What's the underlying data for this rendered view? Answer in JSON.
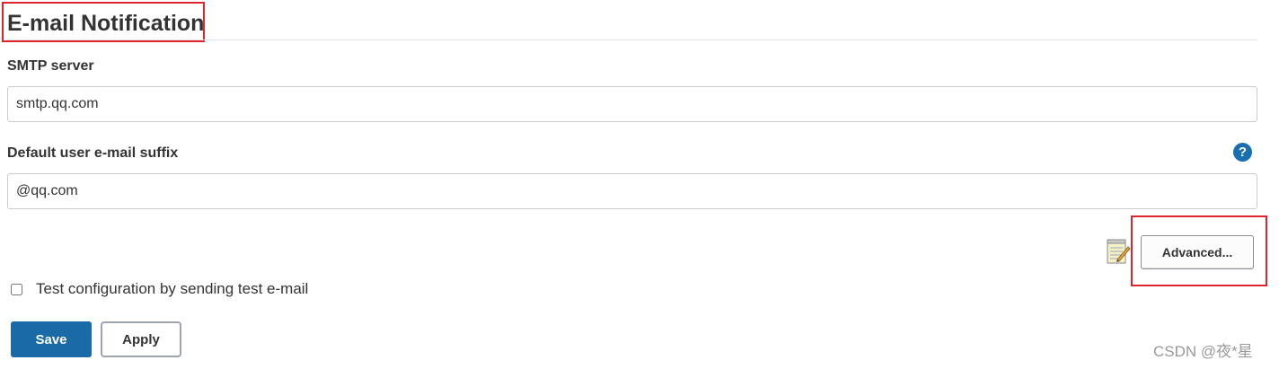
{
  "section": {
    "title": "E-mail Notification"
  },
  "smtp": {
    "label": "SMTP server",
    "value": "smtp.qq.com"
  },
  "suffix": {
    "label": "Default user e-mail suffix",
    "value": "@qq.com",
    "help_icon": "question-circle-icon",
    "help_glyph": "?"
  },
  "advanced": {
    "label": "Advanced...",
    "icon": "notepad-icon"
  },
  "test_config": {
    "label": "Test configuration by sending test e-mail",
    "checked": false
  },
  "actions": {
    "save_label": "Save",
    "apply_label": "Apply"
  },
  "watermark": {
    "text": "CSDN @夜*星"
  },
  "colors": {
    "primary": "#1a6aa8",
    "help_icon": "#1a6fb3",
    "annotation_red": "#e0242d",
    "text": "#333333"
  }
}
